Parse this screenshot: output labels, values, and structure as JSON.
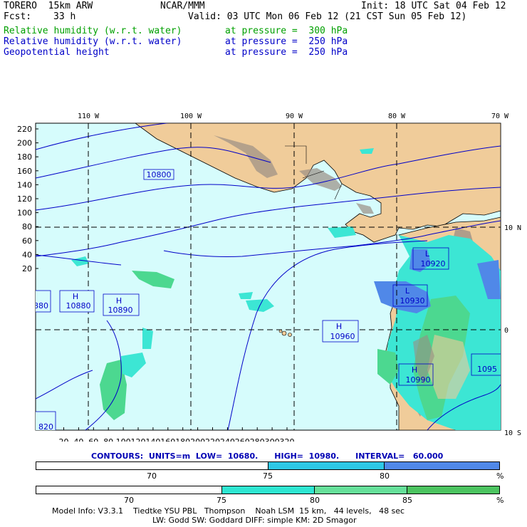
{
  "header": {
    "model": "TORERO  15km ARW",
    "center": "NCAR/MMM",
    "init": "Init: 18 UTC Sat 04 Feb 12",
    "fcst_label": "Fcst:",
    "fcst_value": "33 h",
    "valid": "Valid: 03 UTC Mon 06 Feb 12 (21 CST Sun 05 Feb 12)",
    "fields": [
      {
        "name": "Relative humidity (w.r.t. water)",
        "level": "at pressure =  300 hPa",
        "color": "#00a000"
      },
      {
        "name": "Relative humidity (w.r.t. water)",
        "level": "at pressure =  250 hPa",
        "color": "#0000c8"
      },
      {
        "name": "Geopotential height",
        "level": "at pressure =  250 hPa",
        "color": "#0000c8"
      }
    ]
  },
  "map": {
    "top_labels": [
      "110 W",
      "100 W",
      "90 W",
      "80 W",
      "70 W"
    ],
    "right_labels": [
      "10 N",
      "0",
      "10 S"
    ],
    "left_ticks": [
      "220",
      "200",
      "180",
      "160",
      "140",
      "120",
      "100",
      "80",
      "60",
      "40",
      "20"
    ],
    "bottom_ticks": [
      "20",
      "40",
      "60",
      "80",
      "100",
      "120",
      "140",
      "160",
      "180",
      "200",
      "220",
      "240",
      "260",
      "280",
      "300",
      "320"
    ],
    "contour_labels": [
      "10800"
    ],
    "pressure_centers": [
      {
        "type": "H",
        "value": "10880"
      },
      {
        "type": "H",
        "value": "10890"
      },
      {
        "type": "H",
        "value": "10960"
      },
      {
        "type": "L",
        "value": "10920"
      },
      {
        "type": "L",
        "value": "10930"
      },
      {
        "type": "H",
        "value": "10990"
      }
    ],
    "edge_labels": [
      "880",
      "820",
      "1095"
    ],
    "colors": {
      "ocean": "#d6fcfc",
      "land": "#f0cc9a",
      "mountain": "#9a8e84",
      "rh_blue": "#5088e8",
      "rh_cyan": "#3ce6d4",
      "rh_green": "#4cd890"
    }
  },
  "contours_line": {
    "label": "CONTOURS:  UNITS=m  LOW=  10680.      HIGH=  10980.      INTERVAL=   60.000"
  },
  "legend_250": {
    "segments": [
      {
        "color": "#ffffff"
      },
      {
        "color": "#2ec8e6"
      },
      {
        "color": "#5088e8"
      }
    ],
    "labels": [
      "70",
      "75",
      "80",
      "%"
    ]
  },
  "legend_300": {
    "segments": [
      {
        "color": "#ffffff"
      },
      {
        "color": "#2ee6d2"
      },
      {
        "color": "#66e09a"
      },
      {
        "color": "#4cc460"
      }
    ],
    "labels": [
      "70",
      "75",
      "80",
      "85",
      "%"
    ]
  },
  "footer": {
    "line1": "Model Info: V3.3.1    Tiedtke YSU PBL   Thompson    Noah LSM  15 km,   44 levels,   48 sec",
    "line2": "LW: Godd SW: Goddard DIFF: simple KM: 2D Smagor"
  }
}
